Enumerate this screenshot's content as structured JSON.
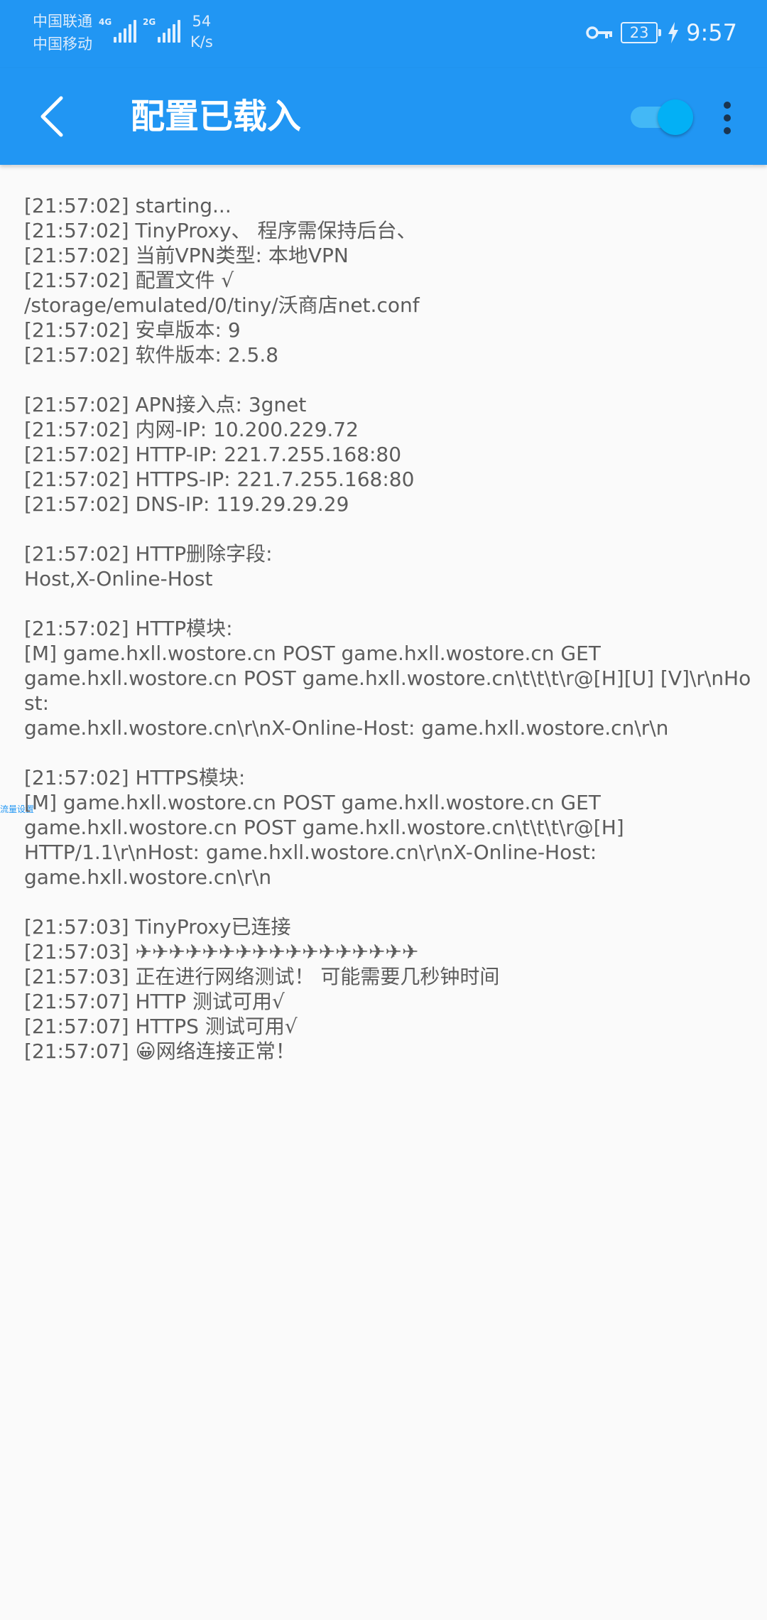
{
  "status_bar": {
    "carrier_1": "中国联通",
    "carrier_2": "中国移动",
    "sim1_tag": "4G",
    "sim2_tag": "2G",
    "net_speed_value": "54",
    "net_speed_unit": "K/s",
    "battery_level": "23",
    "time": "9:57"
  },
  "app_bar": {
    "title": "配置已载入",
    "toggle_on": true
  },
  "side_hint": "流量设置",
  "log_lines": [
    "[21:57:02] starting...",
    "[21:57:02] TinyProxy、 程序需保持后台、",
    "[21:57:02] 当前VPN类型: 本地VPN",
    "[21:57:02] 配置文件 √",
    "/storage/emulated/0/tiny/沃商店net.conf",
    "[21:57:02] 安卓版本: 9",
    "[21:57:02] 软件版本: 2.5.8",
    "",
    "[21:57:02] APN接入点: 3gnet",
    "[21:57:02] 内网-IP: 10.200.229.72",
    "[21:57:02] HTTP-IP: 221.7.255.168:80",
    "[21:57:02] HTTPS-IP: 221.7.255.168:80",
    "[21:57:02] DNS-IP: 119.29.29.29",
    "",
    "[21:57:02] HTTP删除字段:",
    "Host,X-Online-Host",
    "",
    "[21:57:02] HTTP模块:",
    "[M] game.hxll.wostore.cn POST game.hxll.wostore.cn GET",
    "game.hxll.wostore.cn POST game.hxll.wostore.cn\\t\\t\\t\\r@[H][U] [V]\\r\\nHost:",
    "game.hxll.wostore.cn\\r\\nX-Online-Host: game.hxll.wostore.cn\\r\\n",
    "",
    "[21:57:02] HTTPS模块:",
    "[M] game.hxll.wostore.cn POST game.hxll.wostore.cn GET",
    "game.hxll.wostore.cn POST game.hxll.wostore.cn\\t\\t\\t\\r@[H]",
    "HTTP/1.1\\r\\nHost: game.hxll.wostore.cn\\r\\nX-Online-Host:",
    "game.hxll.wostore.cn\\r\\n",
    "",
    "[21:57:03] TinyProxy已连接",
    "[21:57:03] ✈✈✈✈✈✈✈✈✈✈✈✈✈✈✈✈✈",
    "[21:57:03] 正在进行网络测试！ 可能需要几秒钟时间",
    "[21:57:07] HTTP 测试可用√",
    "[21:57:07] HTTPS 测试可用√",
    "[21:57:07] 😀网络连接正常！"
  ]
}
